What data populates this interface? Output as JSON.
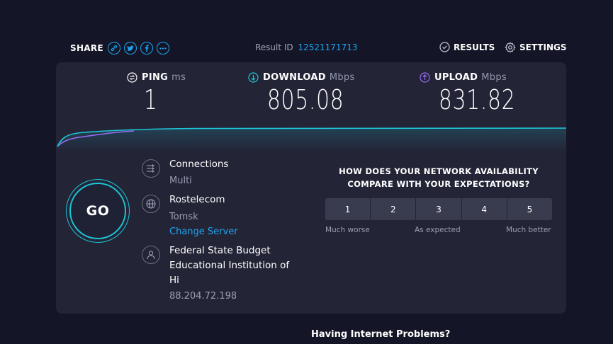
{
  "header": {
    "share_label": "SHARE",
    "share_icons": [
      "link-icon",
      "twitter-icon",
      "facebook-icon",
      "more-icon"
    ],
    "result_id_label": "Result ID",
    "result_id": "12521171713",
    "results_label": "RESULTS",
    "settings_label": "SETTINGS"
  },
  "metrics": {
    "ping": {
      "label": "PING",
      "unit": "ms",
      "value": "1"
    },
    "download": {
      "label": "DOWNLOAD",
      "unit": "Mbps",
      "value": "805.08"
    },
    "upload": {
      "label": "UPLOAD",
      "unit": "Mbps",
      "value": "831.82"
    }
  },
  "go_label": "GO",
  "connections": {
    "title": "Connections",
    "value": "Multi"
  },
  "server": {
    "name": "Rostelecom",
    "location": "Tomsk",
    "change_label": "Change Server"
  },
  "provider": {
    "name_lines": [
      "Federal State Budget",
      "Educational Institution of",
      "Hi"
    ],
    "ip": "88.204.72.198"
  },
  "survey": {
    "question_lines": [
      "HOW DOES YOUR NETWORK AVAILABILITY",
      "COMPARE WITH YOUR EXPECTATIONS?"
    ],
    "options": [
      "1",
      "2",
      "3",
      "4",
      "5"
    ],
    "scale_low": "Much worse",
    "scale_mid": "As expected",
    "scale_high": "Much better"
  },
  "footer": {
    "problems_label": "Having Internet Problems?"
  },
  "colors": {
    "background": "#141526",
    "card": "#232537",
    "accent_blue": "#1ea5f0",
    "cyan": "#1cc5d6",
    "purple": "#9b6bf2"
  }
}
